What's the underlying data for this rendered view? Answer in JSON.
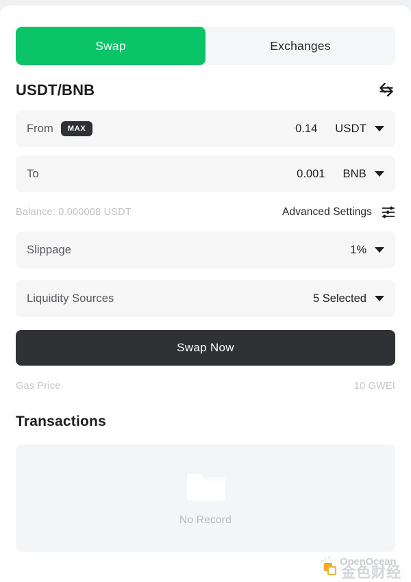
{
  "tabs": [
    {
      "label": "Swap",
      "active": true
    },
    {
      "label": "Exchanges",
      "active": false
    }
  ],
  "pair": {
    "title": "USDT/BNB",
    "swap_icon": "swap-horizontal-icon"
  },
  "from_field": {
    "label": "From",
    "max_label": "MAX",
    "amount": "0.14",
    "token": "USDT",
    "caret_icon": "chevron-down-icon"
  },
  "to_field": {
    "label": "To",
    "amount": "0.001",
    "token": "BNB",
    "caret_icon": "chevron-down-icon"
  },
  "meta": {
    "balance": "Balance: 0.000008 USDT",
    "advanced_settings": "Advanced Settings",
    "settings_icon": "sliders-icon"
  },
  "slippage": {
    "label": "Slippage",
    "value": "1%"
  },
  "liquidity": {
    "label": "Liquidity Sources",
    "value": "5 Selected"
  },
  "swap_button": {
    "label": "Swap Now"
  },
  "gas": {
    "label": "Gas Price",
    "value": "10 GWEI"
  },
  "transactions": {
    "heading": "Transactions",
    "empty_icon": "folder-icon",
    "empty_text": "No Record"
  },
  "watermark": {
    "brand": "OpenOcean",
    "overlay_text": "金色财经",
    "logo_icon": "openocean-logo-icon"
  },
  "colors": {
    "accent_green": "#0cc468",
    "dark_button": "#303134",
    "row_bg": "#f6f6f7",
    "muted_text": "#bfc2c6"
  }
}
